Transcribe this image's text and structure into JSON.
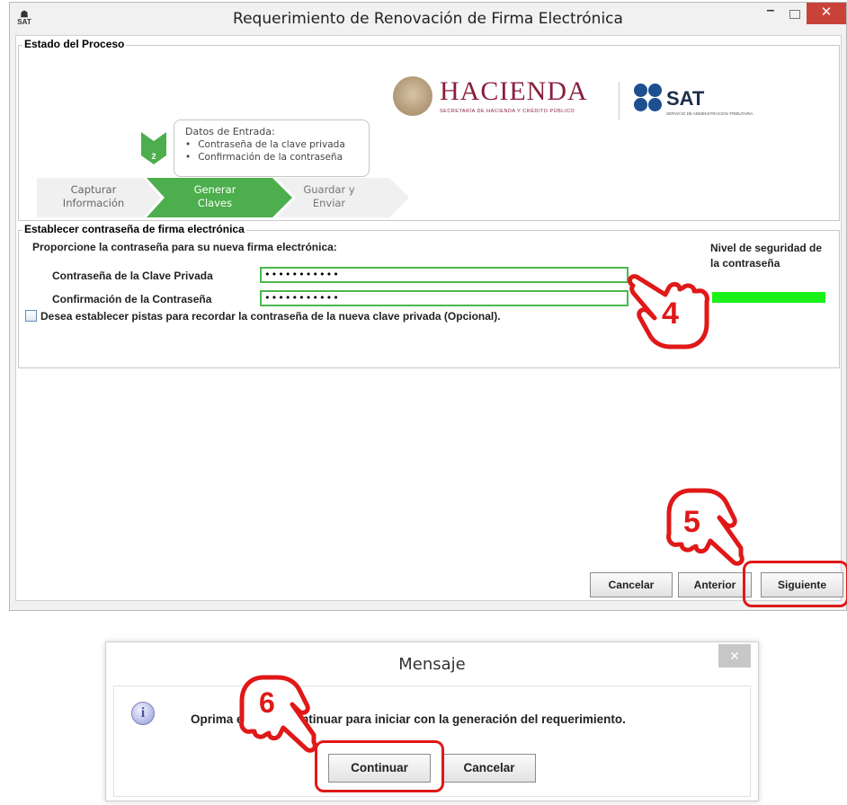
{
  "window": {
    "title": "Requerimiento de Renovación de Firma Electrónica",
    "app_icon_text": "SAT",
    "min_glyph": "–",
    "close_glyph": "✕"
  },
  "process": {
    "group_label": "Estado del Proceso",
    "logo_hacienda": "HACIENDA",
    "logo_hacienda_sub": "SECRETARÍA DE HACIENDA Y CRÉDITO PÚBLICO",
    "logo_sat": "SAT",
    "logo_sat_sub": "SERVICIO DE ADMINISTRACIÓN TRIBUTARIA",
    "callout_title": "Datos de Entrada:",
    "callout_items": [
      "Contraseña de la clave privada",
      "Confirmación de la contraseña"
    ],
    "step_number": "2",
    "steps": [
      {
        "line1": "Capturar",
        "line2": "Información"
      },
      {
        "line1": "Generar",
        "line2": "Claves"
      },
      {
        "line1": "Guardar y",
        "line2": "Enviar"
      }
    ],
    "colors": {
      "inactive": "#f0f0f0",
      "active": "#4cae4c"
    }
  },
  "password": {
    "group_label": "Establecer contraseña de firma electrónica",
    "prompt": "Proporcione la contraseña para su nueva firma electrónica:",
    "private_key_label": "Contraseña de la Clave Privada",
    "private_key_value": "•••••••••••",
    "confirm_label": "Confirmación de la Contraseña",
    "confirm_value": "•••••••••••",
    "security_label": "Nivel de seguridad de la contraseña",
    "security_color": "#19f219",
    "hints_checkbox_label": "Desea establecer pistas para recordar la contraseña de la nueva clave privada (Opcional)."
  },
  "buttons": {
    "cancel": "Cancelar",
    "back": "Anterior",
    "next": "Siguiente"
  },
  "annotations": {
    "step4": "4",
    "step5": "5",
    "step6": "6",
    "color": "#e01818"
  },
  "dialog": {
    "title": "Mensaje",
    "close_glyph": "✕",
    "icon_glyph": "i",
    "message": "Oprima el botón continuar para iniciar con la generación del requerimiento.",
    "continue": "Continuar",
    "cancel": "Cancelar"
  }
}
